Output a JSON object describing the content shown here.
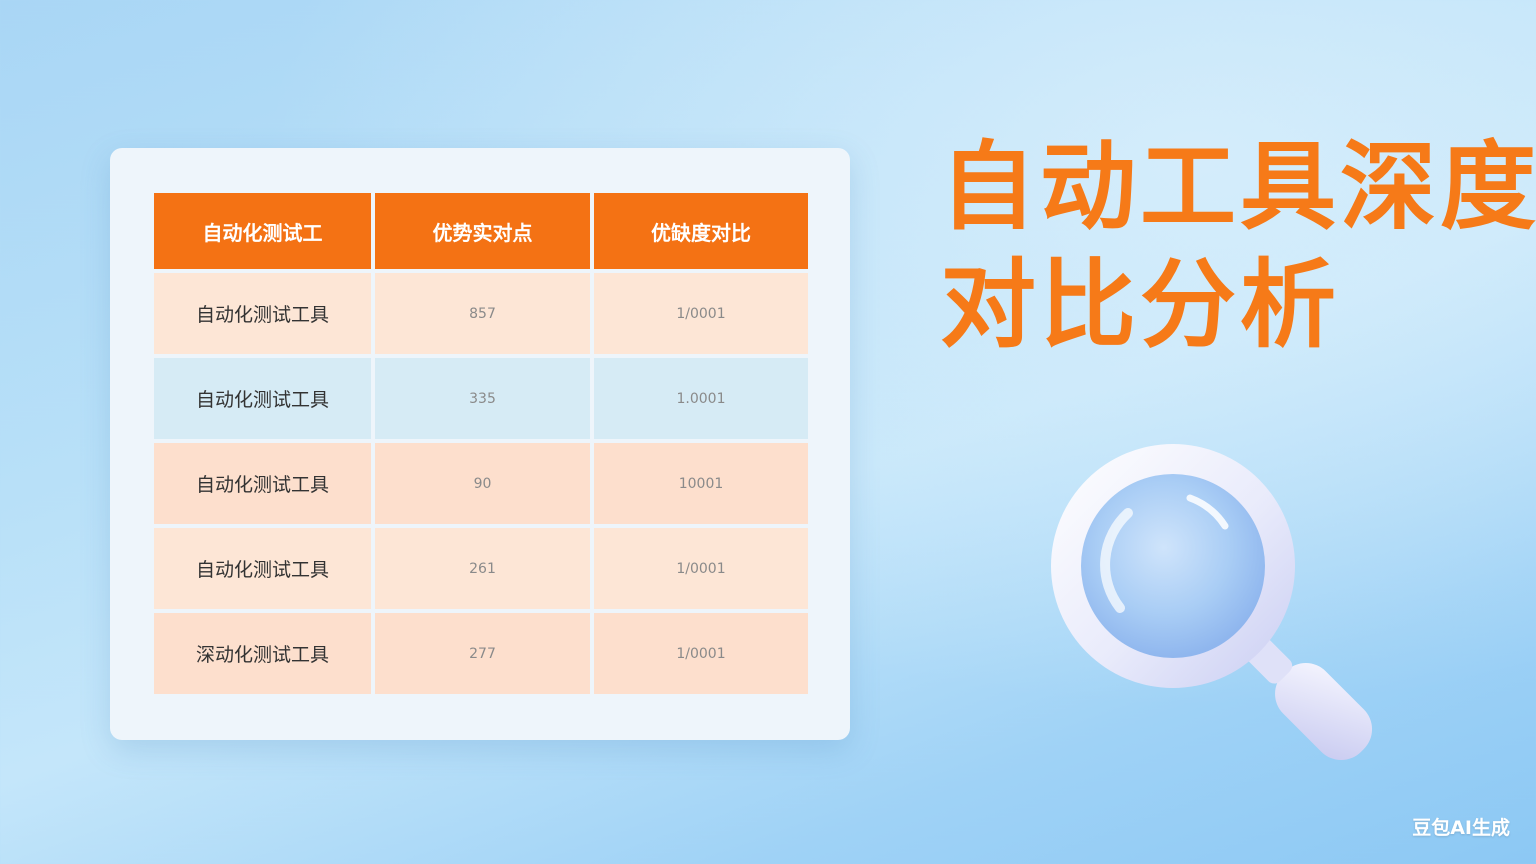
{
  "title": {
    "line1": "自动工具深度",
    "line2": "对比分析"
  },
  "table": {
    "headers": [
      "自动化测试工",
      "优势实对点",
      "优缺度对比"
    ],
    "rows": [
      {
        "name": "自动化测试工具",
        "col2": "857",
        "col3": "1/0001"
      },
      {
        "name": "自动化测试工具",
        "col2": "335",
        "col3": "1.0001"
      },
      {
        "name": "自动化测试工具",
        "col2": "90",
        "col3": "10001"
      },
      {
        "name": "自动化测试工具",
        "col2": "261",
        "col3": "1/0001"
      },
      {
        "name": "深动化测试工具",
        "col2": "277",
        "col3": "1/0001"
      }
    ]
  },
  "watermark": "豆包AI生成",
  "icons": {
    "magnifier": "magnifying-glass-icon"
  },
  "colors": {
    "accent": "#f47214",
    "title": "#f67a18",
    "row_peach": "#fde6d6",
    "row_blue": "#d6ebf5"
  }
}
